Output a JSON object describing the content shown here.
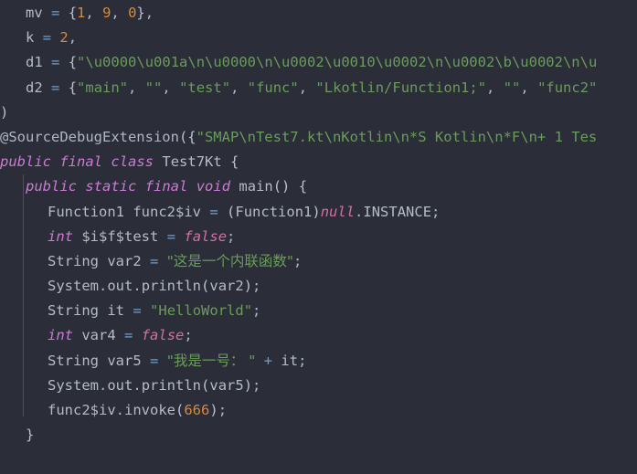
{
  "editor": {
    "language": "java",
    "theme": "darcula",
    "background_color": "#2b2d38",
    "default_text_color": "#a9b7c6",
    "indent_guide_color": "#4b4f5e",
    "colors": {
      "keyword": "#cc7bd4",
      "literal_keyword": "#d66ea6",
      "number": "#d9873f",
      "string": "#6a9c5b",
      "operator": "#6c9fd1",
      "identifier": "#b4bcc8",
      "annotation": "#b0b6c8"
    }
  },
  "code": {
    "lines": [
      {
        "indent": 1,
        "tokens": [
          {
            "type": "ident",
            "text": "mv"
          },
          {
            "type": "plain",
            "text": " "
          },
          {
            "type": "op",
            "text": "="
          },
          {
            "type": "plain",
            "text": " "
          },
          {
            "type": "brace",
            "text": "{"
          },
          {
            "type": "num",
            "text": "1"
          },
          {
            "type": "punct",
            "text": ", "
          },
          {
            "type": "num",
            "text": "9"
          },
          {
            "type": "punct",
            "text": ", "
          },
          {
            "type": "num",
            "text": "0"
          },
          {
            "type": "brace",
            "text": "}"
          },
          {
            "type": "punct",
            "text": ","
          }
        ]
      },
      {
        "indent": 1,
        "tokens": [
          {
            "type": "ident",
            "text": "k"
          },
          {
            "type": "plain",
            "text": " "
          },
          {
            "type": "op",
            "text": "="
          },
          {
            "type": "plain",
            "text": " "
          },
          {
            "type": "num",
            "text": "2"
          },
          {
            "type": "punct",
            "text": ","
          }
        ]
      },
      {
        "indent": 1,
        "tokens": [
          {
            "type": "ident",
            "text": "d1"
          },
          {
            "type": "plain",
            "text": " "
          },
          {
            "type": "op",
            "text": "="
          },
          {
            "type": "plain",
            "text": " "
          },
          {
            "type": "brace",
            "text": "{"
          },
          {
            "type": "str",
            "text": "\"\\u0000\\u001a\\n\\u0000\\n\\u0002\\u0010\\u0002\\n\\u0002\\b\\u0002\\n\\u"
          }
        ]
      },
      {
        "indent": 1,
        "tokens": [
          {
            "type": "ident",
            "text": "d2"
          },
          {
            "type": "plain",
            "text": " "
          },
          {
            "type": "op",
            "text": "="
          },
          {
            "type": "plain",
            "text": " "
          },
          {
            "type": "brace",
            "text": "{"
          },
          {
            "type": "str",
            "text": "\"main\""
          },
          {
            "type": "punct",
            "text": ", "
          },
          {
            "type": "str",
            "text": "\"\""
          },
          {
            "type": "punct",
            "text": ", "
          },
          {
            "type": "str",
            "text": "\"test\""
          },
          {
            "type": "punct",
            "text": ", "
          },
          {
            "type": "str",
            "text": "\"func\""
          },
          {
            "type": "punct",
            "text": ", "
          },
          {
            "type": "str",
            "text": "\"Lkotlin/Function1;\""
          },
          {
            "type": "punct",
            "text": ", "
          },
          {
            "type": "str",
            "text": "\"\""
          },
          {
            "type": "punct",
            "text": ", "
          },
          {
            "type": "str",
            "text": "\"func2\""
          }
        ]
      },
      {
        "indent": 0,
        "tokens": [
          {
            "type": "brace",
            "text": ")"
          }
        ]
      },
      {
        "indent": 0,
        "tokens": [
          {
            "type": "anno",
            "text": "@SourceDebugExtension"
          },
          {
            "type": "brace",
            "text": "({"
          },
          {
            "type": "str",
            "text": "\"SMAP\\nTest7.kt\\nKotlin\\n*S Kotlin\\n*F\\n+ 1 Tes"
          }
        ]
      },
      {
        "indent": 0,
        "tokens": [
          {
            "type": "kw",
            "text": "public"
          },
          {
            "type": "plain",
            "text": " "
          },
          {
            "type": "kw",
            "text": "final"
          },
          {
            "type": "plain",
            "text": " "
          },
          {
            "type": "kw",
            "text": "class"
          },
          {
            "type": "plain",
            "text": " "
          },
          {
            "type": "type",
            "text": "Test7Kt"
          },
          {
            "type": "plain",
            "text": " "
          },
          {
            "type": "brace",
            "text": "{"
          }
        ]
      },
      {
        "indent": 1,
        "tokens": [
          {
            "type": "kw",
            "text": "public"
          },
          {
            "type": "plain",
            "text": " "
          },
          {
            "type": "kw",
            "text": "static"
          },
          {
            "type": "plain",
            "text": " "
          },
          {
            "type": "kw",
            "text": "final"
          },
          {
            "type": "plain",
            "text": " "
          },
          {
            "type": "kw",
            "text": "void"
          },
          {
            "type": "plain",
            "text": " "
          },
          {
            "type": "ident",
            "text": "main"
          },
          {
            "type": "brace",
            "text": "()"
          },
          {
            "type": "plain",
            "text": " "
          },
          {
            "type": "brace",
            "text": "{"
          }
        ]
      },
      {
        "indent": 2,
        "tokens": [
          {
            "type": "type",
            "text": "Function1"
          },
          {
            "type": "plain",
            "text": " "
          },
          {
            "type": "ident",
            "text": "func2$iv"
          },
          {
            "type": "plain",
            "text": " "
          },
          {
            "type": "op",
            "text": "="
          },
          {
            "type": "plain",
            "text": " "
          },
          {
            "type": "brace",
            "text": "("
          },
          {
            "type": "type",
            "text": "Function1"
          },
          {
            "type": "brace",
            "text": ")"
          },
          {
            "type": "kw2",
            "text": "null"
          },
          {
            "type": "punct",
            "text": "."
          },
          {
            "type": "ident",
            "text": "INSTANCE"
          },
          {
            "type": "punct",
            "text": ";"
          }
        ]
      },
      {
        "indent": 2,
        "tokens": [
          {
            "type": "kw",
            "text": "int"
          },
          {
            "type": "plain",
            "text": " "
          },
          {
            "type": "ident",
            "text": "$i$f$test"
          },
          {
            "type": "plain",
            "text": " "
          },
          {
            "type": "op",
            "text": "="
          },
          {
            "type": "plain",
            "text": " "
          },
          {
            "type": "kw2",
            "text": "false"
          },
          {
            "type": "punct",
            "text": ";"
          }
        ]
      },
      {
        "indent": 2,
        "tokens": [
          {
            "type": "type",
            "text": "String"
          },
          {
            "type": "plain",
            "text": " "
          },
          {
            "type": "ident",
            "text": "var2"
          },
          {
            "type": "plain",
            "text": " "
          },
          {
            "type": "op",
            "text": "="
          },
          {
            "type": "plain",
            "text": " "
          },
          {
            "type": "str-cjk",
            "text": "\"这是一个内联函数\""
          },
          {
            "type": "punct",
            "text": ";"
          }
        ]
      },
      {
        "indent": 2,
        "tokens": [
          {
            "type": "type",
            "text": "System"
          },
          {
            "type": "punct",
            "text": "."
          },
          {
            "type": "ident",
            "text": "out"
          },
          {
            "type": "punct",
            "text": "."
          },
          {
            "type": "ident",
            "text": "println"
          },
          {
            "type": "brace",
            "text": "("
          },
          {
            "type": "ident",
            "text": "var2"
          },
          {
            "type": "brace",
            "text": ")"
          },
          {
            "type": "punct",
            "text": ";"
          }
        ]
      },
      {
        "indent": 2,
        "tokens": [
          {
            "type": "type",
            "text": "String"
          },
          {
            "type": "plain",
            "text": " "
          },
          {
            "type": "ident",
            "text": "it"
          },
          {
            "type": "plain",
            "text": " "
          },
          {
            "type": "op",
            "text": "="
          },
          {
            "type": "plain",
            "text": " "
          },
          {
            "type": "str",
            "text": "\"HelloWorld\""
          },
          {
            "type": "punct",
            "text": ";"
          }
        ]
      },
      {
        "indent": 2,
        "tokens": [
          {
            "type": "kw",
            "text": "int"
          },
          {
            "type": "plain",
            "text": " "
          },
          {
            "type": "ident",
            "text": "var4"
          },
          {
            "type": "plain",
            "text": " "
          },
          {
            "type": "op",
            "text": "="
          },
          {
            "type": "plain",
            "text": " "
          },
          {
            "type": "kw2",
            "text": "false"
          },
          {
            "type": "punct",
            "text": ";"
          }
        ]
      },
      {
        "indent": 2,
        "tokens": [
          {
            "type": "type",
            "text": "String"
          },
          {
            "type": "plain",
            "text": " "
          },
          {
            "type": "ident",
            "text": "var5"
          },
          {
            "type": "plain",
            "text": " "
          },
          {
            "type": "op",
            "text": "="
          },
          {
            "type": "plain",
            "text": " "
          },
          {
            "type": "str-cjk",
            "text": "\"我是一号： \""
          },
          {
            "type": "plain",
            "text": " "
          },
          {
            "type": "op",
            "text": "+"
          },
          {
            "type": "plain",
            "text": " "
          },
          {
            "type": "ident",
            "text": "it"
          },
          {
            "type": "punct",
            "text": ";"
          }
        ]
      },
      {
        "indent": 2,
        "tokens": [
          {
            "type": "type",
            "text": "System"
          },
          {
            "type": "punct",
            "text": "."
          },
          {
            "type": "ident",
            "text": "out"
          },
          {
            "type": "punct",
            "text": "."
          },
          {
            "type": "ident",
            "text": "println"
          },
          {
            "type": "brace",
            "text": "("
          },
          {
            "type": "ident",
            "text": "var5"
          },
          {
            "type": "brace",
            "text": ")"
          },
          {
            "type": "punct",
            "text": ";"
          }
        ]
      },
      {
        "indent": 2,
        "tokens": [
          {
            "type": "ident",
            "text": "func2$iv"
          },
          {
            "type": "punct",
            "text": "."
          },
          {
            "type": "ident",
            "text": "invoke"
          },
          {
            "type": "brace",
            "text": "("
          },
          {
            "type": "num",
            "text": "666"
          },
          {
            "type": "brace",
            "text": ")"
          },
          {
            "type": "punct",
            "text": ";"
          }
        ]
      },
      {
        "indent": 1,
        "tokens": [
          {
            "type": "brace",
            "text": "}"
          }
        ]
      }
    ]
  }
}
